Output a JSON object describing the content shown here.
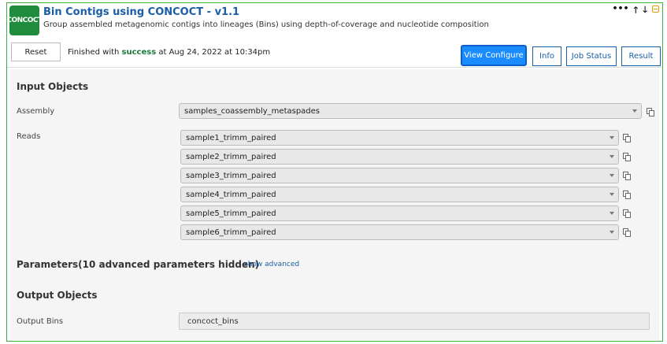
{
  "app": {
    "logo_text": "CONCOCT",
    "title": "Bin Contigs using CONCOCT - v1.1",
    "subtitle": "Group assembled metagenomic contigs into lineages (Bins) using depth-of-coverage and nucleotide composition",
    "accent_color": "#3cb43c"
  },
  "header_controls": {
    "more": "•••",
    "up": "🡑",
    "down": "🡓"
  },
  "toolbar": {
    "reset_label": "Reset",
    "status_prefix": "Finished with ",
    "status_word": "success",
    "status_suffix": " at Aug 24, 2022 at 10:34pm",
    "view_configure_label": "View Configure",
    "info_label": "Info",
    "job_status_label": "Job Status",
    "result_label": "Result"
  },
  "input_objects": {
    "section_title": "Input Objects",
    "assembly_label": "Assembly",
    "assembly_value": "samples_coassembly_metaspades",
    "reads_label": "Reads",
    "reads": [
      "sample1_trimm_paired",
      "sample2_trimm_paired",
      "sample3_trimm_paired",
      "sample4_trimm_paired",
      "sample5_trimm_paired",
      "sample6_trimm_paired"
    ]
  },
  "parameters": {
    "section_title": "Parameters(10 advanced parameters hidden)",
    "show_advanced": "show advanced"
  },
  "output_objects": {
    "section_title": "Output Objects",
    "output_bins_label": "Output Bins",
    "output_bins_value": "concoct_bins"
  }
}
